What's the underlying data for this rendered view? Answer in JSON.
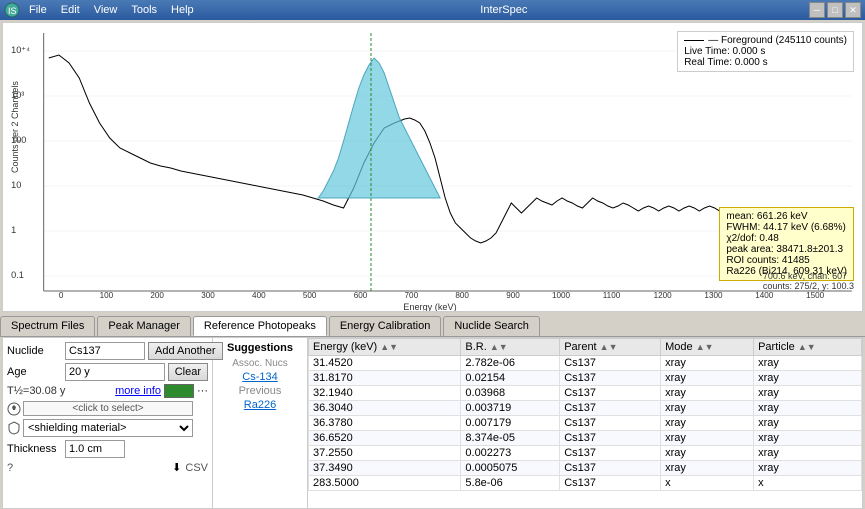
{
  "titleBar": {
    "title": "InterSpec",
    "icon": "interspec-icon"
  },
  "menuBar": {
    "items": [
      "File",
      "Edit",
      "View",
      "Tools",
      "Help"
    ]
  },
  "chart": {
    "yLabel": "Counts per 2 Channels",
    "xLabel": "Energy (keV)",
    "legend": {
      "line": "— Foreground (245110 counts)",
      "liveTime": "Live Time:  0.000 s",
      "realTime": "Real Time:  0.000 s"
    },
    "statsBox": {
      "mean": "mean: 661.26 keV",
      "fwhm": "FWHM: 44.17 keV (6.68%)",
      "chi2": "χ2/dof: 0.48",
      "peakArea": "peak area: 38471.8±201.3",
      "roiCounts": "ROI counts: 41485",
      "nuclide": "Ra226 (Bi214, 609.31 keV)"
    },
    "posLabel": "700.6 keV, chan: 607\ncounts: 275/2, y: 100.3"
  },
  "tabs": [
    {
      "id": "spectrum-files",
      "label": "Spectrum Files",
      "active": false
    },
    {
      "id": "peak-manager",
      "label": "Peak Manager",
      "active": false
    },
    {
      "id": "reference-photopeaks",
      "label": "Reference Photopeaks",
      "active": true
    },
    {
      "id": "energy-calibration",
      "label": "Energy Calibration",
      "active": false
    },
    {
      "id": "nuclide-search",
      "label": "Nuclide Search",
      "active": false
    }
  ],
  "leftPanel": {
    "nuclideLabel": "Nuclide",
    "nuclideValue": "Cs137",
    "addAnotherLabel": "Add Another",
    "ageLabel": "Age",
    "ageValue": "20 y",
    "clearLabel": "Clear",
    "halfLife": "T½=30.08 y",
    "moreInfo": "more info",
    "detectorLabel": "<click to select>",
    "shieldingLabel": "<shielding material>",
    "thicknessLabel": "Thickness",
    "thicknessValue": "1.0 cm",
    "csvLabel": "CSV"
  },
  "middlePanel": {
    "suggestionsLabel": "Suggestions",
    "assocNucsLabel": "Assoc. Nucs",
    "cs134": "Cs-134",
    "previousLabel": "Previous",
    "ra226": "Ra226"
  },
  "table": {
    "headers": [
      "Energy (keV)",
      "B.R.",
      "Parent",
      "Mode",
      "Particle"
    ],
    "rows": [
      [
        "31.4520",
        "2.782e-06",
        "Cs137",
        "xray",
        "xray"
      ],
      [
        "31.8170",
        "0.02154",
        "Cs137",
        "xray",
        "xray"
      ],
      [
        "32.1940",
        "0.03968",
        "Cs137",
        "xray",
        "xray"
      ],
      [
        "36.3040",
        "0.003719",
        "Cs137",
        "xray",
        "xray"
      ],
      [
        "36.3780",
        "0.007179",
        "Cs137",
        "xray",
        "xray"
      ],
      [
        "36.6520",
        "8.374e-05",
        "Cs137",
        "xray",
        "xray"
      ],
      [
        "37.2550",
        "0.002273",
        "Cs137",
        "xray",
        "xray"
      ],
      [
        "37.3490",
        "0.0005075",
        "Cs137",
        "xray",
        "xray"
      ],
      [
        "283.5000",
        "5.8e-06",
        "Cs137",
        "x",
        "x"
      ]
    ]
  }
}
